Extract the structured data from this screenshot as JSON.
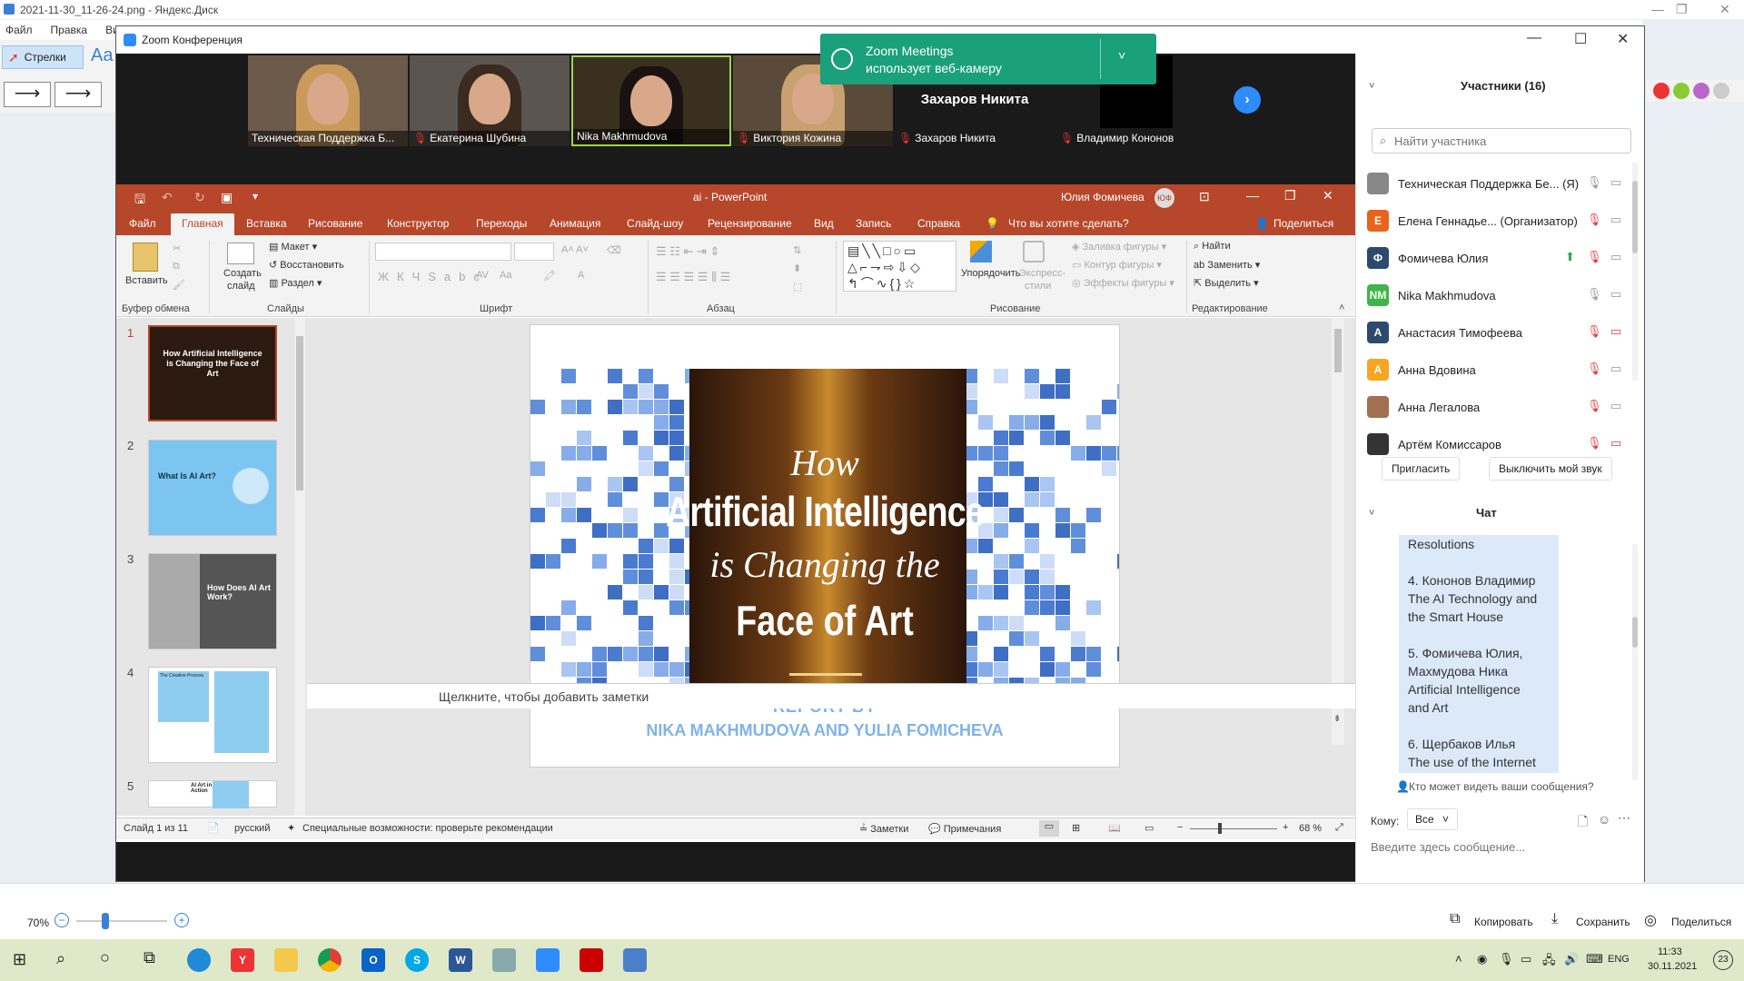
{
  "bg": {
    "window_title": "2021-11-30_11-26-24.png - Яндекс.Диск",
    "menu": [
      "Файл",
      "Правка",
      "Вид"
    ],
    "tool_label": "Стрелки",
    "tool_font": "Aa",
    "zoom_pct": "70%",
    "actions": {
      "copy": "Копировать",
      "save": "Сохранить",
      "share": "Поделиться"
    }
  },
  "zoom": {
    "title": "Zoom Конференция",
    "videos": [
      {
        "name": "Техническая Поддержка Б...",
        "muted": false
      },
      {
        "name": "Екатерина Шубина",
        "muted": true
      },
      {
        "name": "Nika Makhmudova",
        "muted": false
      },
      {
        "name": "Виктория Кожина",
        "muted": true
      },
      {
        "name": "Захаров Никита",
        "muted": true,
        "no_video": true,
        "big": "Захаров Никита"
      },
      {
        "name": "Владимир Кононов",
        "muted": true
      }
    ],
    "notification": {
      "line1": "Zoom Meetings",
      "line2": "использует веб-камеру"
    }
  },
  "ppt": {
    "file": "ai - PowerPoint",
    "user": "Юлия Фомичева",
    "user_init": "ЮФ",
    "tabs": [
      "Файл",
      "Главная",
      "Вставка",
      "Рисование",
      "Конструктор",
      "Переходы",
      "Анимация",
      "Слайд-шоу",
      "Рецензирование",
      "Вид",
      "Запись",
      "Справка"
    ],
    "tell_me": "Что вы хотите сделать?",
    "share": "Поделиться",
    "ribbon": {
      "paste": "Вставить",
      "clipboard": "Буфер обмена",
      "new_slide_1": "Создать",
      "new_slide_2": "слайд",
      "layout": "Макет",
      "reset": "Восстановить",
      "section": "Раздел",
      "slides": "Слайды",
      "font": "Шрифт",
      "paragraph": "Абзац",
      "arrange": "Упорядочить",
      "quick_styles_1": "Экспресс-",
      "quick_styles_2": "стили",
      "fill": "Заливка фигуры",
      "outline": "Контур фигуры",
      "effects": "Эффекты фигуры",
      "drawing": "Рисование",
      "find": "Найти",
      "replace": "Заменить",
      "select": "Выделить",
      "editing": "Редактирование"
    },
    "slide": {
      "how": "How",
      "ai": "Artificial Intelligence",
      "changing": "is Changing the",
      "face": "Face of Art",
      "report1": "REPORT BY",
      "report2": "NIKA MAKHMUDOVA AND YULIA FOMICHEVA"
    },
    "thumbs": [
      {
        "n": "1",
        "title": "How Artificial Intelligence is Changing the Face of Art"
      },
      {
        "n": "2",
        "title": "What Is AI Art?"
      },
      {
        "n": "3",
        "title": "How Does AI Art Work?"
      },
      {
        "n": "4",
        "title": "The Creative Process"
      },
      {
        "n": "5",
        "title": "AI Art in Action"
      }
    ],
    "notes": "Щелкните, чтобы добавить заметки",
    "status": {
      "slide": "Слайд 1 из 11",
      "lang": "русский",
      "access": "Специальные возможности: проверьте рекомендации",
      "notes": "Заметки",
      "comments": "Примечания",
      "zoom": "68 %"
    }
  },
  "panel": {
    "participants_title": "Участники (16)",
    "search_placeholder": "Найти участника",
    "participants": [
      {
        "name": "Техническая Поддержка Бе... (Я)",
        "init": "",
        "color": "#888888"
      },
      {
        "name": "Елена Геннадье... (Организатор)",
        "init": "Е",
        "color": "#e8641b"
      },
      {
        "name": "Фомичева Юлия",
        "init": "Ф",
        "color": "#2c4a6e"
      },
      {
        "name": "Nika Makhmudova",
        "init": "NM",
        "color": "#3fb449"
      },
      {
        "name": "Анастасия Тимофеева",
        "init": "А",
        "color": "#2c4a6e"
      },
      {
        "name": "Анна Вдовина",
        "init": "А",
        "color": "#f5a623"
      },
      {
        "name": "Анна Легалова",
        "init": "",
        "color": "#a07050"
      },
      {
        "name": "Артём Комиссаров",
        "init": "",
        "color": "#333333"
      }
    ],
    "invite": "Пригласить",
    "mute_me": "Выключить мой звук",
    "chat_title": "Чат",
    "chat_lines": [
      "Resolutions",
      "",
      "4. Кононов Владимир",
      "The AI Technology and",
      "the Smart House",
      "",
      "5. Фомичева Юлия,",
      "Махмудова Ника",
      "Artificial Intelligence",
      "and Art",
      "",
      "6. Щербаков  Илья",
      "The use of the Internet"
    ],
    "who_sees": "Кто может видеть ваши сообщения?",
    "to_label": "Кому:",
    "to_value": "Все",
    "input_placeholder": "Введите здесь сообщение..."
  },
  "taskbar": {
    "lang": "ENG",
    "time": "11:33",
    "date": "30.11.2021",
    "notif": "23"
  }
}
